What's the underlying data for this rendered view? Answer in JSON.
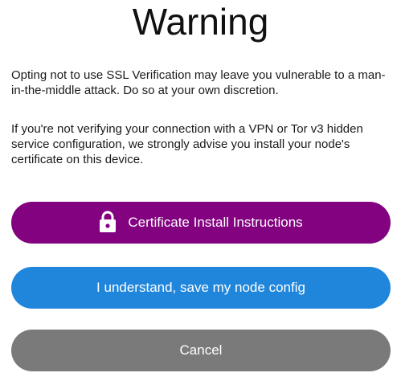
{
  "dialog": {
    "title": "Warning",
    "paragraphs": [
      "Opting not to use SSL Verification may leave you vulnerable to a man-in-the-middle attack. Do so at your own discretion.",
      "If you're not verifying your connection with a VPN or Tor v3 hidden service configuration, we strongly advise you install your node's certificate on this device."
    ],
    "buttons": {
      "certificate": {
        "label": "Certificate Install Instructions",
        "icon": "lock-icon",
        "color": "#820280"
      },
      "save": {
        "label": "I understand, save my node config",
        "color": "#1f86dc"
      },
      "cancel": {
        "label": "Cancel",
        "color": "#7a7a7a"
      }
    }
  }
}
